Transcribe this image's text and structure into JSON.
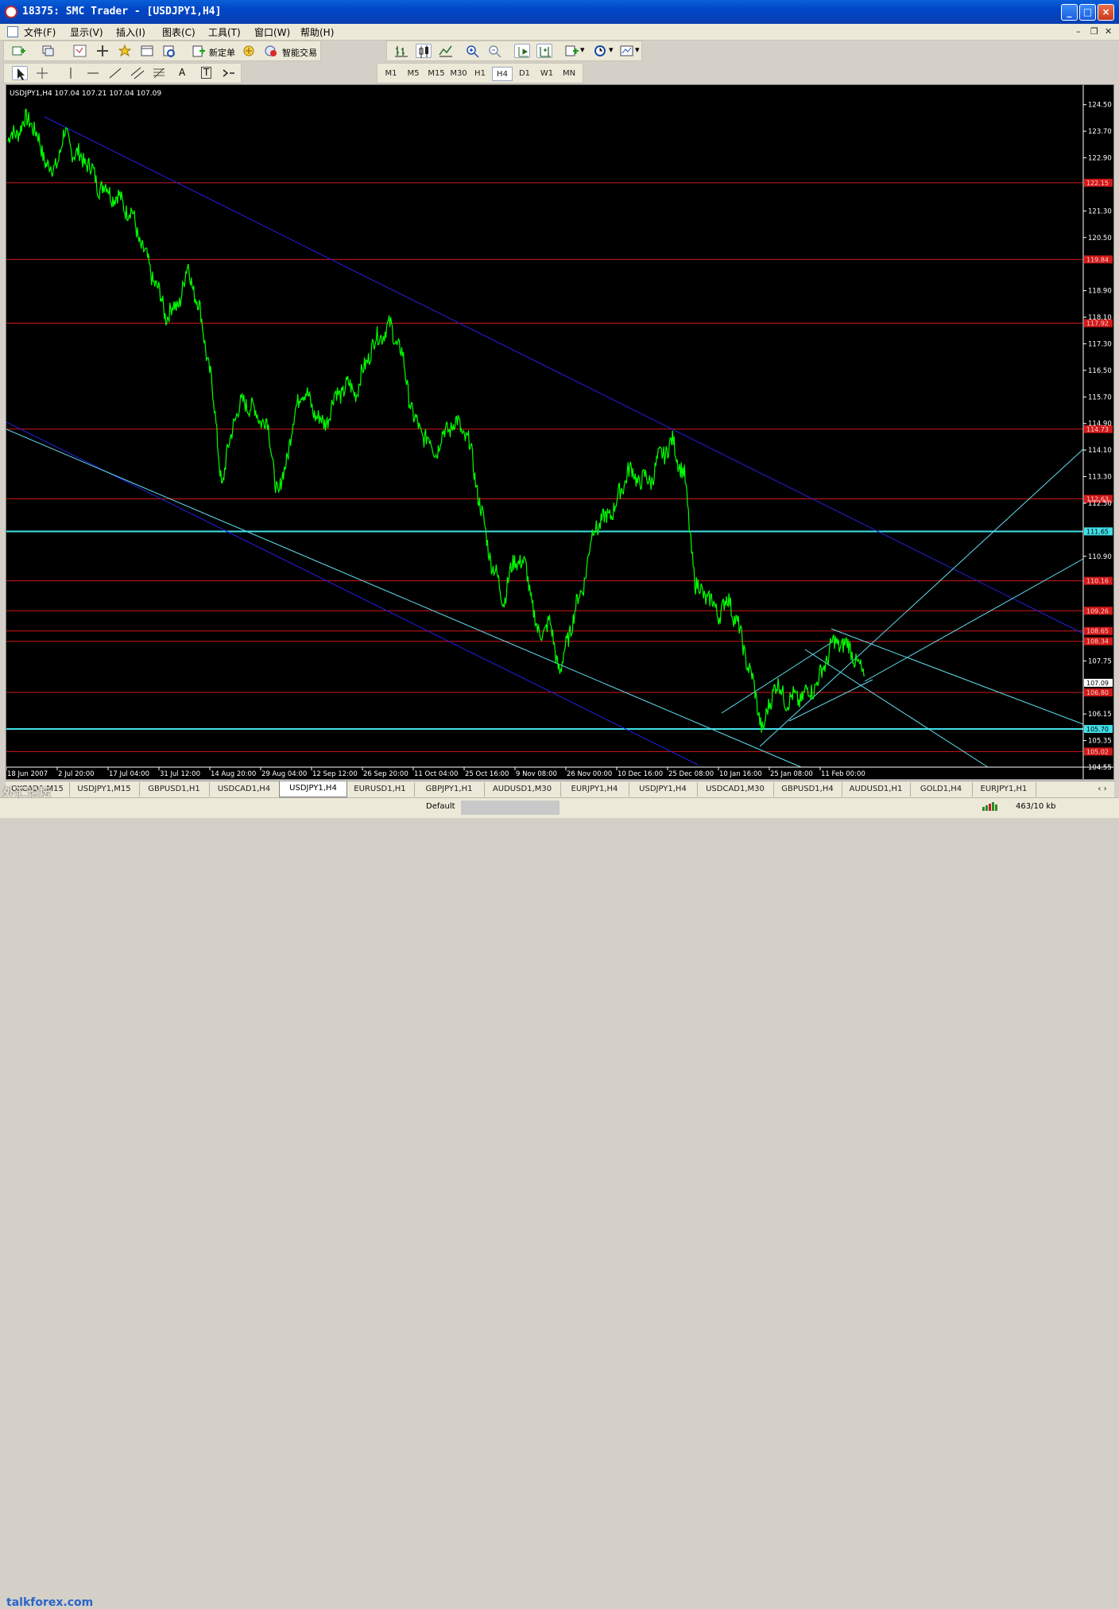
{
  "window": {
    "title": "18375: SMC Trader - [USDJPY1,H4]",
    "minimize": "_",
    "maximize": "□",
    "close": "×"
  },
  "menu": [
    "文件(F)",
    "显示(V)",
    "插入(I)",
    "图表(C)",
    "工具(T)",
    "窗口(W)",
    "帮助(H)"
  ],
  "toolbar": {
    "new_order": "新定单",
    "expert_advisors": "智能交易",
    "line_tools": [
      "A",
      "T"
    ]
  },
  "timeframes": [
    "M1",
    "M5",
    "M15",
    "M30",
    "H1",
    "H4",
    "D1",
    "W1",
    "MN"
  ],
  "active_timeframe": "H4",
  "chart_info": "USDJPY1,H4  107.04 107.21 107.04 107.09",
  "chart_data": {
    "type": "line",
    "symbol": "USDJPY1,H4",
    "ylim": [
      104.55,
      124.9
    ],
    "y_ticks": [
      "124.50",
      "123.70",
      "122.90",
      "121.30",
      "120.50",
      "118.90",
      "118.10",
      "117.30",
      "116.50",
      "115.70",
      "114.90",
      "114.10",
      "113.30",
      "112.50",
      "110.90",
      "107.75",
      "106.15",
      "105.35",
      "104.55"
    ],
    "x_ticks": [
      "18 Jun 2007",
      "2 Jul 20:00",
      "17 Jul 04:00",
      "31 Jul 12:00",
      "14 Aug 20:00",
      "29 Aug 04:00",
      "12 Sep 12:00",
      "26 Sep 20:00",
      "11 Oct 04:00",
      "25 Oct 16:00",
      "9 Nov 08:00",
      "26 Nov 00:00",
      "10 Dec 16:00",
      "25 Dec 08:00",
      "10 Jan 16:00",
      "25 Jan 08:00",
      "11 Feb 00:00"
    ],
    "price_path": [
      123.4,
      123.8,
      124.1,
      123.1,
      122.4,
      123.6,
      123.0,
      122.8,
      122.1,
      121.9,
      121.6,
      121.2,
      120.1,
      119.2,
      118.2,
      118.4,
      119.6,
      118.3,
      116.3,
      113.0,
      115.0,
      115.6,
      115.2,
      114.9,
      112.6,
      114.4,
      116.0,
      115.4,
      114.8,
      115.7,
      116.0,
      115.9,
      117.0,
      117.6,
      117.8,
      116.9,
      115.0,
      114.5,
      114.1,
      114.8,
      114.9,
      114.2,
      112.2,
      110.6,
      109.6,
      110.9,
      110.5,
      108.5,
      108.9,
      107.4,
      108.9,
      110.0,
      111.8,
      112.0,
      112.5,
      113.5,
      113.2,
      113.2,
      114.0,
      114.3,
      113.3,
      110.0,
      109.7,
      109.2,
      109.6,
      108.5,
      107.2,
      105.6,
      107.1,
      106.6,
      106.6,
      106.8,
      107.2,
      108.2,
      108.3,
      108.0,
      107.09
    ],
    "support_resistance": [
      {
        "price": 122.15,
        "label": "122.15",
        "color": "#d01818"
      },
      {
        "price": 119.84,
        "label": "119.84",
        "color": "#d01818"
      },
      {
        "price": 117.92,
        "label": "117.92",
        "color": "#d01818"
      },
      {
        "price": 114.73,
        "label": "114.73",
        "color": "#d01818"
      },
      {
        "price": 112.63,
        "label": "112.63",
        "color": "#d01818"
      },
      {
        "price": 111.65,
        "label": "111.65",
        "color": "#40e0e8"
      },
      {
        "price": 110.16,
        "label": "110.16",
        "color": "#d01818"
      },
      {
        "price": 109.26,
        "label": "109.26",
        "color": "#d01818"
      },
      {
        "price": 108.65,
        "label": "108.65",
        "color": "#d01818"
      },
      {
        "price": 108.34,
        "label": "108.34",
        "color": "#d01818"
      },
      {
        "price": 106.8,
        "label": "106.80",
        "color": "#d01818"
      },
      {
        "price": 105.7,
        "label": "105.70",
        "color": "#40e0e8"
      },
      {
        "price": 105.02,
        "label": "105.02",
        "color": "#d01818"
      }
    ],
    "current_price": {
      "price": 107.09,
      "label": "107.09"
    },
    "colors": {
      "price": "#00ff00",
      "background": "#000000",
      "axis": "#ffffff",
      "blue_channel": "#2020e0",
      "cyan_trend": "#60e0f0"
    }
  },
  "tabs": [
    "OXCAD1,M15",
    "USDJPY1,M15",
    "GBPUSD1,H1",
    "USDCAD1,H4",
    "USDJPY1,H4",
    "EURUSD1,H1",
    "GBPJPY1,H1",
    "AUDUSD1,M30",
    "EURJPY1,H4",
    "USDJPY1,H4",
    "USDCAD1,M30",
    "GBPUSD1,H4",
    "AUDUSD1,H1",
    "GOLD1,H4",
    "EURJPY1,H1"
  ],
  "active_tab": "USDJPY1,H4",
  "status": {
    "profile": "Default",
    "traffic": "463/10 kb"
  },
  "watermark": {
    "cn": "外汇论坛",
    "site": "talkforex.com"
  }
}
